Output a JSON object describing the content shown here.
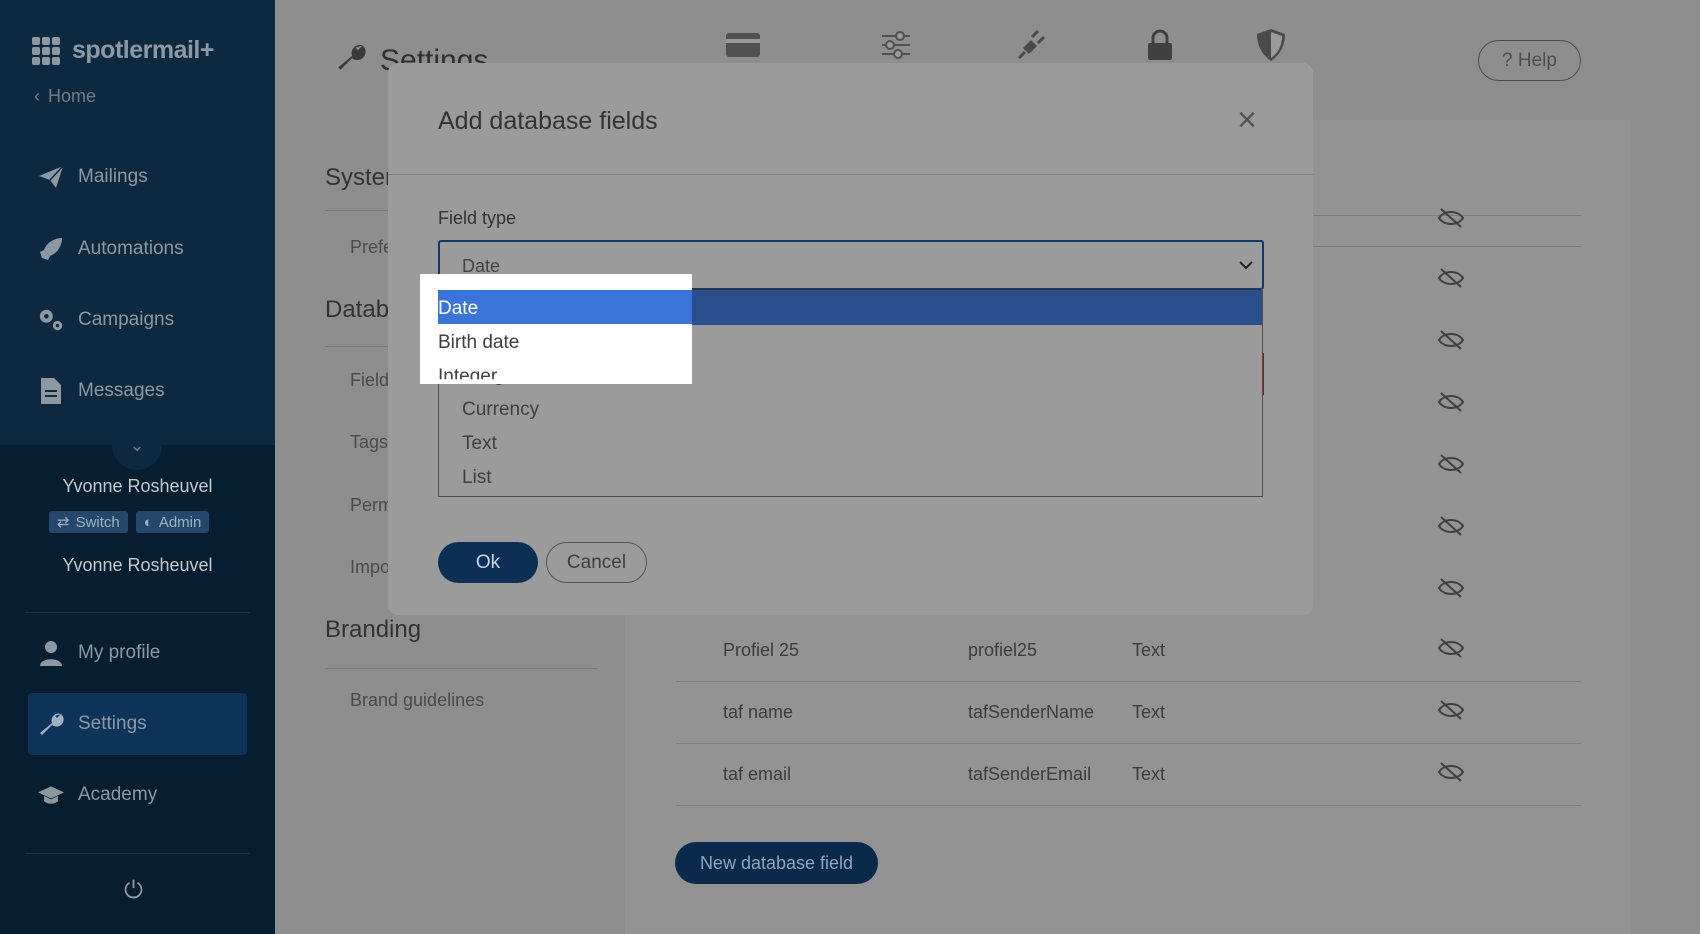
{
  "sidebar": {
    "logo": "spotlermail+",
    "home": "Home",
    "nav": [
      {
        "label": "Mailings",
        "icon": "paper-plane-icon"
      },
      {
        "label": "Automations",
        "icon": "rocket-icon"
      },
      {
        "label": "Campaigns",
        "icon": "gears-icon"
      },
      {
        "label": "Messages",
        "icon": "document-icon"
      }
    ],
    "user_name": "Yvonne Rosheuvel",
    "switch_label": "Switch",
    "admin_label": "Admin",
    "account_name": "Yvonne Rosheuvel",
    "bottom_nav": [
      {
        "label": "My profile",
        "icon": "user-icon"
      },
      {
        "label": "Settings",
        "icon": "wrench-icon"
      },
      {
        "label": "Academy",
        "icon": "graduation-cap-icon"
      }
    ]
  },
  "header": {
    "title": "Settings",
    "help": "? Help"
  },
  "left_panel": {
    "system_heading": "Syster",
    "system_item": "Prefe",
    "database_heading": "Datab",
    "database_items": [
      "Field",
      "Tags",
      "Perm",
      "Impo"
    ],
    "branding_heading": "Branding",
    "branding_items": [
      "Brand guidelines"
    ]
  },
  "table": {
    "rows": [
      {
        "name": "Profiel 25",
        "key": "profiel25",
        "type": "Text"
      },
      {
        "name": "taf name",
        "key": "tafSenderName",
        "type": "Text"
      },
      {
        "name": "taf email",
        "key": "tafSenderEmail",
        "type": "Text"
      }
    ]
  },
  "new_field_button": "New database field",
  "modal": {
    "title": "Add database fields",
    "field_type_label": "Field type",
    "selected_value": "Date",
    "options": [
      "Date",
      "Birth date",
      "Integer",
      "Currency",
      "Text",
      "List"
    ],
    "ok": "Ok",
    "cancel": "Cancel"
  }
}
